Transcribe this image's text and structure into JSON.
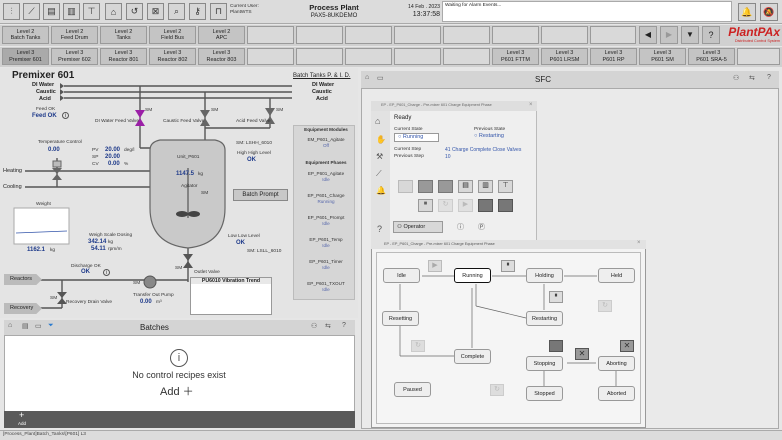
{
  "toolbar": {
    "current_user_label": "Current User:",
    "current_user": "PlantWTS",
    "title": "Process Plant",
    "subtitle": "PAX5-8UKDEMO",
    "date": "14 Feb . 2023",
    "time": "13:37:58",
    "alarm_text": "Waiting for Alarm Events..."
  },
  "nav": {
    "row1": [
      "Level 2\nBatch Tanks",
      "Level 2\nFeed Drum",
      "Level 2\nTanks",
      "Level 2\nField Bus",
      "Level 2\nAPC"
    ],
    "row2": [
      "Level 3\nPremixer 601",
      "Level 3\nPremixer 602",
      "Level 3\nReactor 801",
      "Level 3\nReactor 802",
      "Level 3\nReactor 803"
    ],
    "row2_right": [
      "Level 3\nP601 FTTM",
      "Level 3\nP601 LRSM",
      "Level 3\nP601 RP",
      "Level 3\nP601 SM",
      "Level 3\nP601 SRA-5"
    ]
  },
  "logo": {
    "name": "PlantPAx",
    "tag": "Distributed Control System"
  },
  "premixer": {
    "title": "Premixer 601",
    "link": "Batch Tanks P. & I. D.",
    "di_water": "DI Water",
    "caustic": "Caustic",
    "acid": "Acid",
    "feed_ok_label": "Feed OK",
    "feed_ok": "Feed OK",
    "temp_control": "Temperature Control",
    "temp_val": "0.00",
    "temp_unit": "°C",
    "pv_lbl": "PV",
    "pv": "20.00",
    "sp_lbl": "SP",
    "sp": "20.00",
    "cv_lbl": "CV",
    "cv": "0.00",
    "pv_unit": "deg/l",
    "cv_unit": "%",
    "heating": "Heating",
    "cooling": "Cooling",
    "weight": "Weight",
    "weight_val": "1162.1",
    "weight_unit": "kg",
    "weigh_scale": "Weigh Scale Dosing",
    "ws1": "342.14",
    "ws1_unit": "kg",
    "ws2": "54.11",
    "ws2_unit": "rpm/m",
    "discharge": "Discharge OK",
    "discharge_val": "OK",
    "reactors": "Reactors",
    "recovery": "Recovery",
    "recovery_valve": "Recovery Drain Valve",
    "transfer_pump": "Transfer Out Pump",
    "transfer_val": "0.00",
    "transfer_unit": "m³",
    "di_feed_valve": "DI Water Feed Valve",
    "caustic_feed_valve": "Caustic Feed Valve",
    "acid_feed_valve": "Acid Feed Valve",
    "unit": "Unit_P601",
    "level": "1147.5",
    "level_unit": "kg",
    "agitator": "Agitator",
    "high_level": "High High Level",
    "high_level_val": "OK",
    "lsh": "SM: LSHH_6010",
    "low_level": "Low Low Level",
    "low_level_val": "OK",
    "lsl": "SM: LSLL_6010",
    "outlet": "Outlet Valve",
    "batch_prompt": "Batch Prompt",
    "trend": "PU6010 Vibration Trend",
    "sm": "SM"
  },
  "equipment": {
    "modules_title": "Equipment Modules",
    "agitate": "EM_P601_Agitate",
    "agitate_val": "Off",
    "phases_title": "Equipment Phases",
    "phases": [
      {
        "name": "EP_P601_Agitate",
        "val": "Idle"
      },
      {
        "name": "EP_P601_Charge",
        "val": "Running"
      },
      {
        "name": "EP_P601_Prompt",
        "val": "Idle"
      },
      {
        "name": "EP_P601_Temp",
        "val": "Idle"
      },
      {
        "name": "EP_P601_Timer",
        "val": "Idle"
      },
      {
        "name": "EP_P601_TXOUT",
        "val": "Idle"
      }
    ]
  },
  "batches": {
    "title": "Batches",
    "message": "No control recipes exist",
    "add": "Add",
    "add_small": "Add"
  },
  "sfc": {
    "title": "SFC"
  },
  "faceplate": {
    "title": "EP - EP_P601_Charge - Pre-mixer 601 Charge Equipment Phase",
    "ready": "Ready",
    "current_state_lbl": "Current State",
    "current_state": "Running",
    "previous_state_lbl": "Previous State",
    "previous_state": "Restarting",
    "current_step_lbl": "Current Step",
    "current_step": "41 Charge Complete Close Valves",
    "previous_step_lbl": "Previous Step",
    "previous_step": "10",
    "operator": "Operator"
  },
  "statemodel": {
    "title": "EP - EP_P601_Charge - Pre-mixer 601 Charge Equipment Phase",
    "states": {
      "idle": "Idle",
      "running": "Running",
      "holding": "Holding",
      "held": "Held",
      "resetting": "Resetting",
      "restarting": "Restarting",
      "complete": "Complete",
      "stopping": "Stopping",
      "aborting": "Aborting",
      "paused": "Paused",
      "stopped": "Stopped",
      "aborted": "Aborted"
    }
  },
  "statusbar": {
    "path": "[Process_Plant]Batch_Tanks\\[P601] L3"
  },
  "colors": {
    "accent": "#cc2222",
    "bg": "#e6e6e6"
  }
}
